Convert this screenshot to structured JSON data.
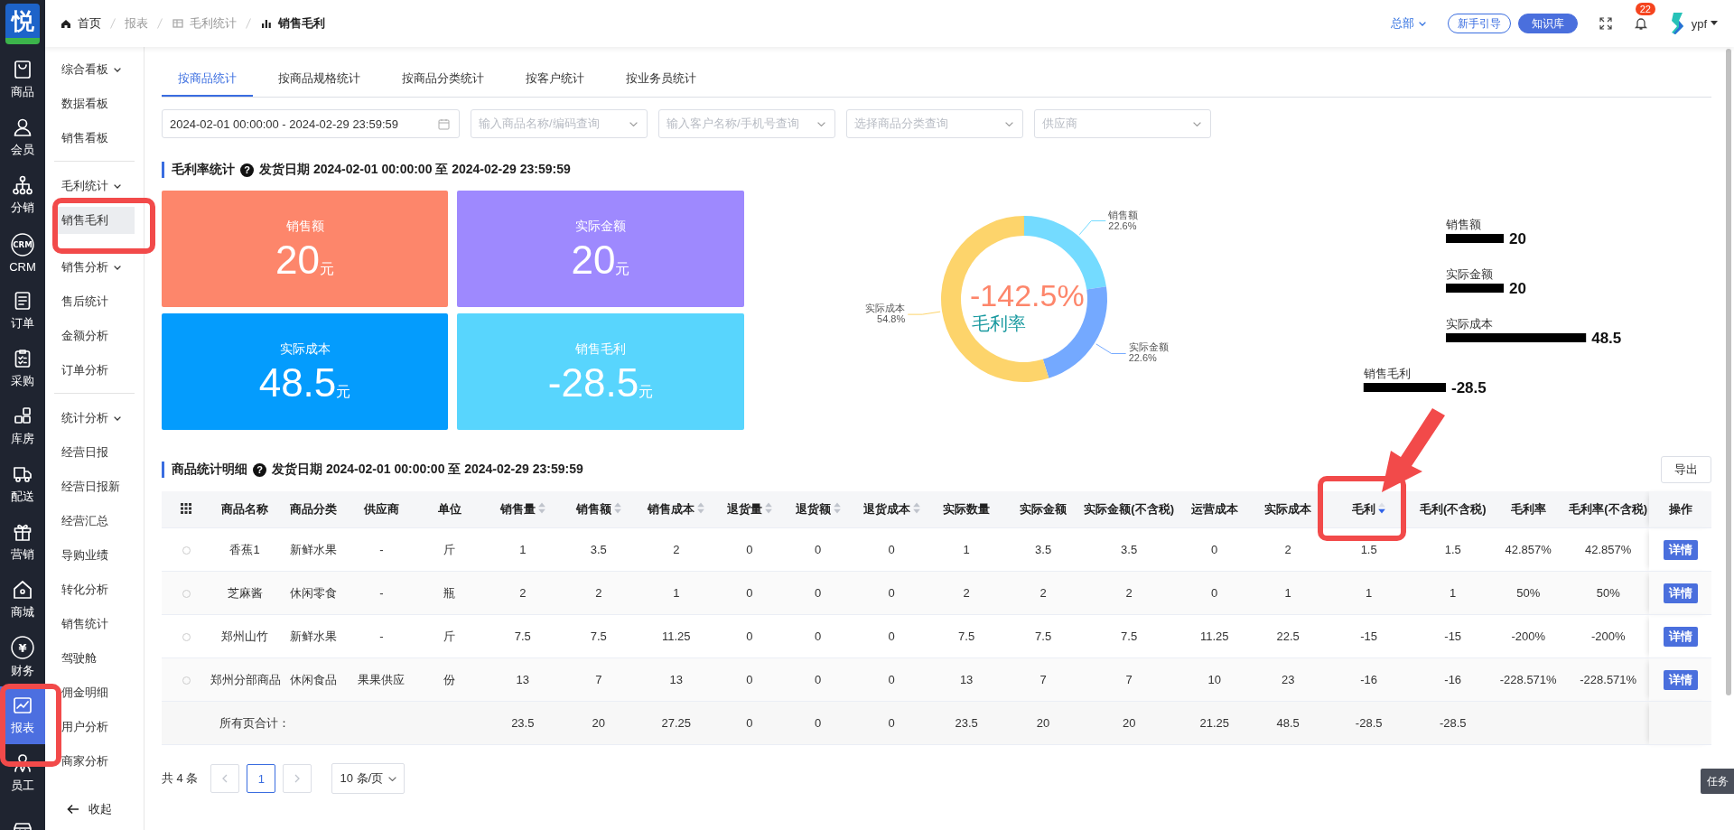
{
  "app_logo": {
    "text": "悦"
  },
  "nav_rail": [
    {
      "label": "商品",
      "kind": "bag",
      "selected": false
    },
    {
      "label": "会员",
      "kind": "person",
      "selected": false
    },
    {
      "label": "分销",
      "kind": "network",
      "selected": false
    },
    {
      "label": "CRM",
      "kind": "crm",
      "icon_text": "CRM",
      "selected": false
    },
    {
      "label": "订单",
      "kind": "doc",
      "selected": false
    },
    {
      "label": "采购",
      "kind": "clipboard",
      "selected": false
    },
    {
      "label": "库房",
      "kind": "boxes",
      "selected": false
    },
    {
      "label": "配送",
      "kind": "truck",
      "selected": false
    },
    {
      "label": "营销",
      "kind": "gift",
      "selected": false
    },
    {
      "label": "商城",
      "kind": "house",
      "selected": false
    },
    {
      "label": "财务",
      "kind": "yen",
      "icon_text": "¥",
      "selected": false
    },
    {
      "label": "报表",
      "kind": "chart",
      "selected": true
    },
    {
      "label": "员工",
      "kind": "staff",
      "selected": false
    },
    {
      "kind": "store",
      "selected": false
    }
  ],
  "menu": {
    "groups": [
      {
        "label": "综合看板",
        "expanded": true,
        "separated": false,
        "children": [
          {
            "label": "数据看板",
            "selected": false
          },
          {
            "label": "销售看板",
            "selected": false
          }
        ]
      },
      {
        "label": "毛利统计",
        "expanded": true,
        "separated": true,
        "children": [
          {
            "label": "销售毛利",
            "selected": true
          }
        ]
      },
      {
        "label": "销售分析",
        "expanded": true,
        "separated": false,
        "children": [
          {
            "label": "售后统计",
            "selected": false
          },
          {
            "label": "金额分析",
            "selected": false
          },
          {
            "label": "订单分析",
            "selected": false
          }
        ]
      },
      {
        "label": "统计分析",
        "expanded": true,
        "separated": true,
        "children": [
          {
            "label": "经营日报",
            "selected": false
          },
          {
            "label": "经营日报新",
            "selected": false
          },
          {
            "label": "经营汇总",
            "selected": false
          },
          {
            "label": "导购业绩",
            "selected": false
          },
          {
            "label": "转化分析",
            "selected": false
          },
          {
            "label": "销售统计",
            "selected": false
          },
          {
            "label": "驾驶舱",
            "selected": false
          },
          {
            "label": "佣金明细",
            "selected": false
          },
          {
            "label": "用户分析",
            "selected": false
          },
          {
            "label": "商家分析",
            "selected": false
          }
        ]
      }
    ],
    "collapse_label": "收起"
  },
  "breadcrumb": [
    {
      "label": "首页",
      "kind": "home",
      "selected": false
    },
    {
      "label": "报表",
      "kind": "plain",
      "selected": false
    },
    {
      "label": "毛利统计",
      "kind": "sheet",
      "selected": false
    },
    {
      "label": "销售毛利",
      "kind": "bars",
      "selected": true
    }
  ],
  "header": {
    "org": "总部",
    "guide_button": "新手引导",
    "kb_button": "知识库",
    "notification_count": "22",
    "user": "ypf"
  },
  "tabs": [
    {
      "label": "按商品统计",
      "selected": true
    },
    {
      "label": "按商品规格统计",
      "selected": false
    },
    {
      "label": "按商品分类统计",
      "selected": false
    },
    {
      "label": "按客户统计",
      "selected": false
    },
    {
      "label": "按业务员统计",
      "selected": false
    }
  ],
  "filters": [
    {
      "kind": "date",
      "value": "2024-02-01 00:00:00 - 2024-02-29 23:59:59"
    },
    {
      "kind": "select",
      "placeholder": "输入商品名称/编码查询"
    },
    {
      "kind": "select",
      "placeholder": "输入客户名称/手机号查询"
    },
    {
      "kind": "select",
      "placeholder": "选择商品分类查询"
    },
    {
      "kind": "select",
      "placeholder": "供应商"
    }
  ],
  "summary": {
    "title": "毛利率统计",
    "help_icon": "?",
    "subtitle": "发货日期 2024-02-01 00:00:00 至 2024-02-29 23:59:59",
    "cards": [
      {
        "label": "销售额",
        "value": "20",
        "unit": "元",
        "color": "#fd866b"
      },
      {
        "label": "实际金额",
        "value": "20",
        "unit": "元",
        "color": "#9e89fe"
      },
      {
        "label": "实际成本",
        "value": "48.5",
        "unit": "元",
        "color": "#049cfd"
      },
      {
        "label": "销售毛利",
        "value": "-28.5",
        "unit": "元",
        "color": "#58d5fd"
      }
    ],
    "donut": {
      "center_value": "-142.5%",
      "center_label": "毛利率",
      "chart_data": {
        "type": "donut",
        "categories": [
          "销售额",
          "实际金额",
          "实际成本"
        ],
        "values": [
          22.6,
          22.6,
          54.8
        ],
        "data_labels": true,
        "value_labels": [
          "22.6%",
          "22.6%",
          "54.8%"
        ]
      }
    },
    "bars": {
      "chart_data": {
        "type": "bar",
        "orientation": "horizontal",
        "categories": [
          "销售额",
          "实际金额",
          "实际成本",
          "销售毛利"
        ],
        "values": [
          20,
          20,
          48.5,
          -28.5
        ],
        "data_labels": true
      }
    }
  },
  "detail": {
    "title": "商品统计明细",
    "help_icon": "?",
    "subtitle": "发货日期 2024-02-01 00:00:00 至 2024-02-29 23:59:59",
    "export_button": "导出",
    "columns": [
      {
        "label": "商品名称",
        "sortable": false,
        "sort_desc": false
      },
      {
        "label": "商品分类",
        "sortable": false,
        "sort_desc": false
      },
      {
        "label": "供应商",
        "sortable": false,
        "sort_desc": false
      },
      {
        "label": "单位",
        "sortable": false,
        "sort_desc": false
      },
      {
        "label": "销售量",
        "sortable": true,
        "sort_desc": false
      },
      {
        "label": "销售额",
        "sortable": true,
        "sort_desc": false
      },
      {
        "label": "销售成本",
        "sortable": true,
        "sort_desc": false
      },
      {
        "label": "退货量",
        "sortable": true,
        "sort_desc": false
      },
      {
        "label": "退货额",
        "sortable": true,
        "sort_desc": false
      },
      {
        "label": "退货成本",
        "sortable": true,
        "sort_desc": false
      },
      {
        "label": "实际数量",
        "sortable": false,
        "sort_desc": false
      },
      {
        "label": "实际金额",
        "sortable": false,
        "sort_desc": false
      },
      {
        "label": "实际金额(不含税)",
        "sortable": false,
        "sort_desc": false
      },
      {
        "label": "运营成本",
        "sortable": false,
        "sort_desc": false
      },
      {
        "label": "实际成本",
        "sortable": false,
        "sort_desc": false
      },
      {
        "label": "毛利",
        "sortable": true,
        "sort_desc": true
      },
      {
        "label": "毛利(不含税)",
        "sortable": false,
        "sort_desc": false
      },
      {
        "label": "毛利率",
        "sortable": false,
        "sort_desc": false
      },
      {
        "label": "毛利率(不含税)",
        "sortable": false,
        "sort_desc": false
      },
      {
        "label": "操作",
        "sortable": false,
        "sort_desc": false
      }
    ],
    "rows": [
      {
        "selected": false,
        "cells": [
          "香蕉1",
          "新鲜水果",
          "-",
          "斤",
          "1",
          "3.5",
          "2",
          "0",
          "0",
          "0",
          "1",
          "3.5",
          "3.5",
          "0",
          "2",
          "1.5",
          "1.5",
          "42.857%",
          "42.857%"
        ],
        "action": "详情"
      },
      {
        "selected": false,
        "cells": [
          "芝麻酱",
          "休闲零食",
          "-",
          "瓶",
          "2",
          "2",
          "1",
          "0",
          "0",
          "0",
          "2",
          "2",
          "2",
          "0",
          "1",
          "1",
          "1",
          "50%",
          "50%"
        ],
        "action": "详情"
      },
      {
        "selected": false,
        "cells": [
          "郑州山竹",
          "新鲜水果",
          "-",
          "斤",
          "7.5",
          "7.5",
          "11.25",
          "0",
          "0",
          "0",
          "7.5",
          "7.5",
          "7.5",
          "11.25",
          "22.5",
          "-15",
          "-15",
          "-200%",
          "-200%"
        ],
        "action": "详情"
      },
      {
        "selected": false,
        "cells": [
          "郑州分部商品",
          "休闲食品",
          "果果供应",
          "份",
          "13",
          "7",
          "13",
          "0",
          "0",
          "0",
          "13",
          "7",
          "7",
          "10",
          "23",
          "-16",
          "-16",
          "-228.571%",
          "-228.571%"
        ],
        "action": "详情"
      }
    ],
    "total": {
      "label": "所有页合计：",
      "cells": [
        null,
        null,
        null,
        "23.5",
        "20",
        "27.25",
        "0",
        "0",
        "0",
        "23.5",
        "20",
        "20",
        "21.25",
        "48.5",
        "-28.5",
        "-28.5",
        null,
        null
      ]
    }
  },
  "pagination": {
    "total_text": "共 4 条",
    "pages": [
      {
        "label": "1",
        "selected": true
      }
    ],
    "page_size": "10 条/页"
  },
  "task_tab": "任务"
}
